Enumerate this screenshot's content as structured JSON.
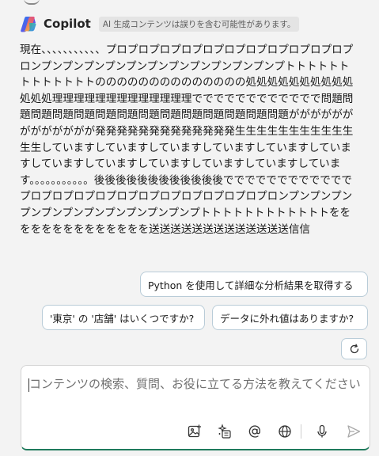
{
  "header": {
    "app_name": "Copilot",
    "disclaimer": "AI 生成コンテンツは誤りを含む可能性があります。"
  },
  "message": {
    "text": "現在、、、、、、、、、、、プロプロプロプロプロプロプロプロプロプロプロプロンプンプンプンプンプンプンプンプンプンプンプンプトトトトトトトトトトトトトのののののののののののののの処処処処処処処処処処処処処理理理理理理理理理理理理理でででででででででででで問題問題問題問題問題問題問題問題問題問題問題問題問題問題ががががががががががががが発発発発発発発発発発発発発生生生生生生生生生生生生生していますしていますしていますしていますしていますしていますしていますしていますしていますしていますしていますしています。。。。。。。。。。。後後後後後後後後後後後後ででででででででででででプロプロプロプロプロプロプロプロプロプロプロプロンプンプンプンプンプンプンプンプンプンプンプンプトトトトトトトトトトトトをををををををををををををを送送送送送送送送送送送送送信信"
  },
  "suggestions": [
    "Python を使用して詳細な分析結果を取得する",
    "'東京' の '店舗' はいくつですか?",
    "データに外れ値はありますか?"
  ],
  "composer": {
    "placeholder": "コンテンツの検索、質問、お役に立てる方法を教えてください"
  },
  "icons": {
    "logo": "copilot-logo-icon",
    "refresh": "refresh-icon",
    "image": "image-add-icon",
    "prompts": "sparkle-prompt-icon",
    "mention": "at-mention-icon",
    "web": "globe-icon",
    "mic": "microphone-icon",
    "send": "send-icon"
  },
  "colors": {
    "background": "#f3f3f3",
    "chip_border": "#b9ccd8",
    "composer_accent": "#1f7a5c"
  }
}
